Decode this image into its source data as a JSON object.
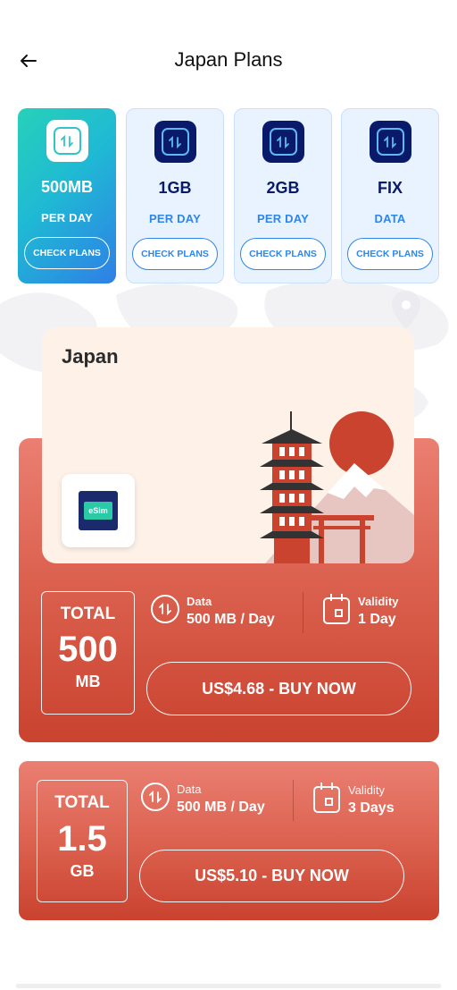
{
  "header": {
    "title": "Japan Plans",
    "back_icon": "arrow-left-icon"
  },
  "plan_tabs": [
    {
      "amount": "500MB",
      "unit": "PER DAY",
      "check_label": "CHECK PLANS",
      "active": true
    },
    {
      "amount": "1GB",
      "unit": "PER DAY",
      "check_label": "CHECK PLANS",
      "active": false
    },
    {
      "amount": "2GB",
      "unit": "PER DAY",
      "check_label": "CHECK PLANS",
      "active": false
    },
    {
      "amount": "FIX",
      "unit": "DATA",
      "check_label": "CHECK PLANS",
      "active": false
    }
  ],
  "hero": {
    "country": "Japan",
    "esim_label": "eSim"
  },
  "plans": [
    {
      "total_label": "TOTAL",
      "total_value": "500",
      "total_unit": "MB",
      "data_label": "Data",
      "data_value": "500 MB / Day",
      "validity_label": "Validity",
      "validity_value": "1 Day",
      "buy_label": "US$4.68 - BUY NOW"
    },
    {
      "total_label": "TOTAL",
      "total_value": "1.5",
      "total_unit": "GB",
      "data_label": "Data",
      "data_value": "500 MB / Day",
      "validity_label": "Validity",
      "validity_value": "3 Days",
      "buy_label": "US$5.10 - BUY NOW"
    }
  ],
  "colors": {
    "brand_navy": "#0a1a6b",
    "accent_blue": "#2f86e8",
    "card_red": "#dc6250",
    "active_gradient_start": "#27d1b8",
    "active_gradient_end": "#2f7fe6"
  }
}
